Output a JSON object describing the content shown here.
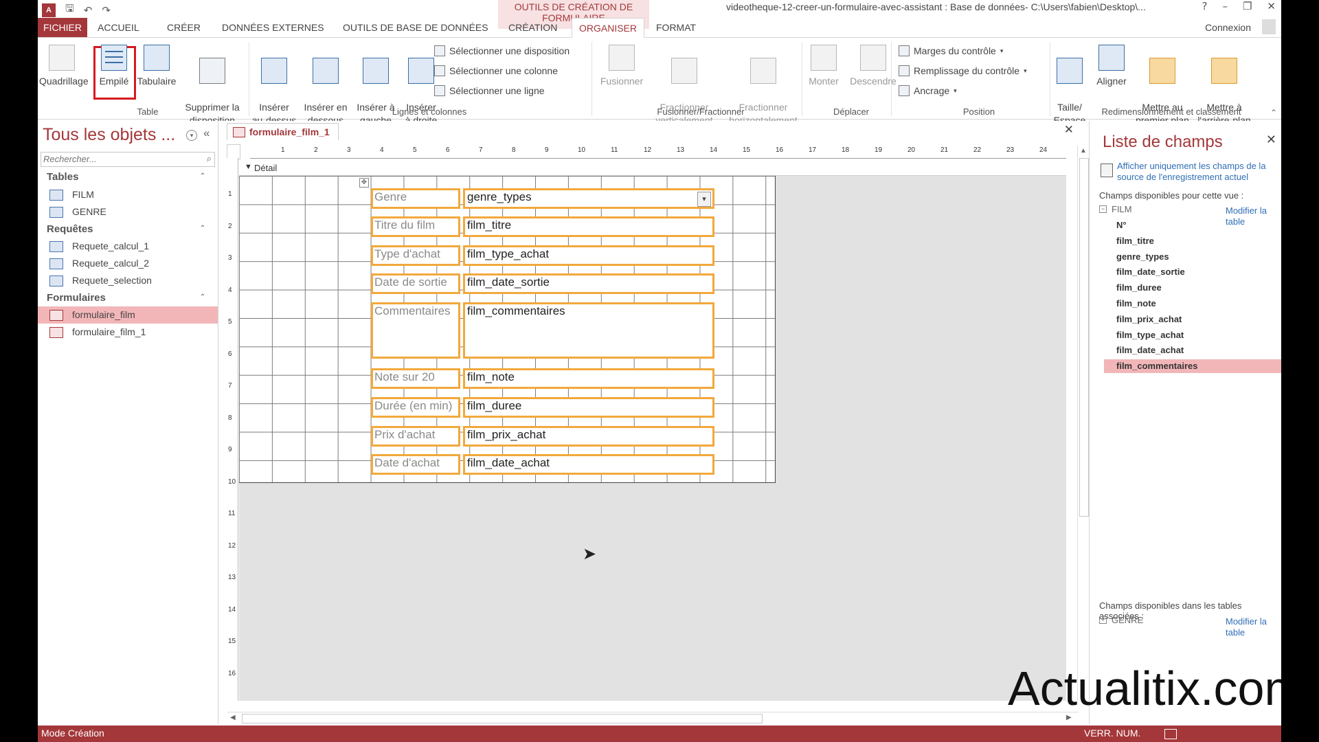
{
  "qat": {
    "undo_icon": "↶",
    "redo_icon": "↷",
    "save_icon": "🖫"
  },
  "title": {
    "context": "OUTILS DE CRÉATION DE FORMULAIRE",
    "window": "videotheque-12-creer-un-formulaire-avec-assistant : Base de données- C:\\Users\\fabien\\Desktop\\...",
    "help": "?"
  },
  "tabs": [
    "FICHIER",
    "ACCUEIL",
    "CRÉER",
    "DONNÉES EXTERNES",
    "OUTILS DE BASE DE DONNÉES",
    "CRÉATION",
    "ORGANISER",
    "FORMAT"
  ],
  "connexion": "Connexion",
  "ribbon": {
    "table": {
      "buttons": [
        "Quadrillage",
        "Empilé",
        "Tabulaire",
        "Supprimer la\ndisposition"
      ],
      "label": "Table"
    },
    "lignes": {
      "buttons": [
        "Insérer\nau-dessus",
        "Insérer en\ndessous",
        "Insérer à\ngauche",
        "Insérer\nà droite"
      ],
      "small": [
        "Sélectionner une disposition",
        "Sélectionner une colonne",
        "Sélectionner une ligne"
      ],
      "label": "Lignes et colonnes"
    },
    "fusion": {
      "buttons": [
        "Fusionner",
        "Fractionner\nverticalement",
        "Fractionner\nhorizontalement"
      ],
      "label": "Fusionner/Fractionner"
    },
    "deplacer": {
      "buttons": [
        "Monter",
        "Descendre"
      ],
      "label": "Déplacer"
    },
    "position": {
      "small": [
        "Marges du contrôle",
        "Remplissage du contrôle",
        "Ancrage"
      ],
      "label": "Position"
    },
    "redim": {
      "buttons": [
        "Taille/\nEspace",
        "Aligner",
        "Mettre au\npremier plan",
        "Mettre à\nl'arrière-plan"
      ],
      "label": "Redimensionnement et classement"
    }
  },
  "nav": {
    "title": "Tous les objets ...",
    "search_placeholder": "Rechercher...",
    "sections": [
      {
        "label": "Tables",
        "items": [
          "FILM",
          "GENRE"
        ]
      },
      {
        "label": "Requêtes",
        "items": [
          "Requete_calcul_1",
          "Requete_calcul_2",
          "Requete_selection"
        ]
      },
      {
        "label": "Formulaires",
        "items": [
          "formulaire_film",
          "formulaire_film_1"
        ]
      }
    ],
    "selected_item": "formulaire_film"
  },
  "doc": {
    "tab": "formulaire_film_1",
    "section": "Détail",
    "ruler_top": [
      "1",
      "2",
      "3",
      "4",
      "5",
      "6",
      "7",
      "8",
      "9",
      "10",
      "11",
      "12",
      "13",
      "14",
      "15",
      "16",
      "17",
      "18",
      "19",
      "20",
      "21",
      "22",
      "23",
      "24"
    ],
    "ruler_left": [
      "1",
      "2",
      "3",
      "4",
      "5",
      "6",
      "7",
      "8",
      "9",
      "10",
      "11",
      "12",
      "13",
      "14",
      "15",
      "16"
    ],
    "controls": [
      {
        "label": "Genre",
        "field": "genre_types",
        "combo": true
      },
      {
        "label": "Titre du film",
        "field": "film_titre"
      },
      {
        "label": "Type d'achat",
        "field": "film_type_achat"
      },
      {
        "label": "Date de sortie",
        "field": "film_date_sortie"
      },
      {
        "label": "Commentaires",
        "field": "film_commentaires",
        "tall": true
      },
      {
        "label": "Note sur 20",
        "field": "film_note"
      },
      {
        "label": "Durée (en min)",
        "field": "film_duree"
      },
      {
        "label": "Prix d'achat",
        "field": "film_prix_achat"
      },
      {
        "label": "Date d'achat",
        "field": "film_date_achat"
      }
    ]
  },
  "fieldlist": {
    "title": "Liste de champs",
    "link": "Afficher uniquement les champs de la source de l'enregistrement actuel",
    "available": "Champs disponibles pour cette vue :",
    "table": "FILM",
    "edit": "Modifier la table",
    "fields": [
      "N°",
      "film_titre",
      "genre_types",
      "film_date_sortie",
      "film_duree",
      "film_note",
      "film_prix_achat",
      "film_type_achat",
      "film_date_achat",
      "film_commentaires"
    ],
    "selected_field": "film_commentaires",
    "related": "Champs disponibles dans les tables associées :",
    "related_table": "GENRE",
    "related_edit": "Modifier la table"
  },
  "watermark": "Actualitix.com",
  "status": {
    "left": "Mode Création",
    "right": "VERR. NUM."
  }
}
